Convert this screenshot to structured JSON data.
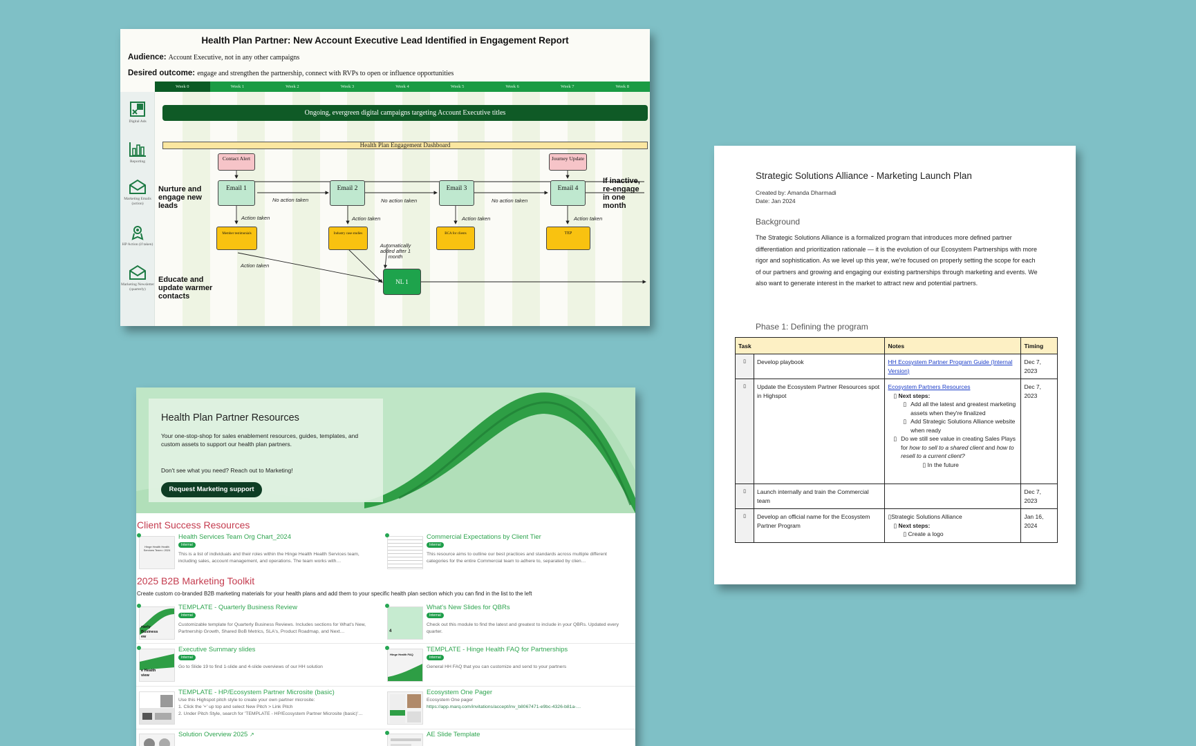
{
  "card1": {
    "title": "Health Plan Partner: New Account Executive Lead Identified in Engagement Report",
    "audience_label": "Audience:",
    "audience_value": "Account Executive, not in any other campaigns",
    "outcome_label": "Desired outcome:",
    "outcome_value": "engage and strengthen the partnership, connect with RVPs to open or influence opportunities",
    "weeks": [
      "Week 0",
      "Week 1",
      "Week 2",
      "Week 3",
      "Week 4",
      "Week 5",
      "Week 6",
      "Week 7",
      "Week 8"
    ],
    "side_icons": [
      "Digital Ads",
      "Reporting",
      "Marketing Emails (action)",
      "HP Action (if taken)",
      "Marketing Newsletter (quarterly)"
    ],
    "evergreen_bar": "Ongoing, evergreen digital campaigns targeting Account Executive titles",
    "dashboard_bar": "Health Plan Engagement Dashboard",
    "contact_alert": "Contact Alert",
    "journey_update": "Journey Update",
    "emails": [
      "Email 1",
      "Email 2",
      "Email 3",
      "Email 4"
    ],
    "no_action": "No action taken",
    "action_taken": "Action taken",
    "actions": [
      "Member testimonials",
      "Industry case studies",
      "BCA for clients",
      "TEP"
    ],
    "auto_added": "Automatically added after 1 month",
    "nl": "NL 1",
    "nurture_label": "Nurture and engage new leads",
    "inactive_label": "If inactive, re-engage in one month",
    "educate_label": "Educate and update warmer contacts"
  },
  "card2": {
    "title": "Strategic Solutions Alliance - Marketing Launch Plan",
    "created_by": "Created by: Amanda Dharmadi",
    "date": "Date: Jan 2024",
    "background_heading": "Background",
    "background_text": "The Strategic Solutions Alliance is a formalized program that introduces more defined partner differentiation and prioritization rationale — it is the evolution of our Ecosystem Partnerships with more rigor and sophistication. As we level up this year, we're focused on properly setting the scope for each of our partners and growing and engaging our existing partnerships through marketing and events. We also want to generate interest in the market to attract new and potential partners.",
    "phase_heading": "Phase 1: Defining the program",
    "table_headers": [
      "Task",
      "Notes",
      "Timing"
    ],
    "rows": [
      {
        "task": "Develop playbook",
        "note_link": "HH Ecosystem Partner Program Guide (Internal Version)",
        "timing": "Dec 7, 2023"
      },
      {
        "task": "Update the Ecosystem Partner Resources spot in Highspot",
        "note_link": "Ecosystem Partners Resources",
        "next_steps": "Next steps:",
        "sub1": "Add all the latest and greatest marketing assets when they're finalized",
        "sub2": "Add Strategic Solutions Alliance website when ready",
        "q_pre": "Do we still see value in creating Sales Plays for ",
        "q_em1": "how to sell to a shared client",
        "q_mid": " and ",
        "q_em2": "how to resell to a current client?",
        "future": "In the future",
        "timing": "Dec 7, 2023"
      },
      {
        "task": "Launch internally and train the Commercial team",
        "timing": "Dec 7, 2023"
      },
      {
        "task": "Develop an official name for the Ecosystem Partner Program",
        "note1": "Strategic Solutions Alliance",
        "next_steps": "Next steps:",
        "sub1": "Create a logo",
        "timing": "Jan 16, 2024"
      }
    ],
    "bullet_glyph": "▯"
  },
  "card3": {
    "hero_title": "Health Plan Partner Resources",
    "hero_desc": "Your one-stop-shop for sales enablement resources, guides, templates, and custom assets to support our health plan partners.",
    "hero_question": "Don't see what you need? Reach out to Marketing!",
    "hero_button": "Request Marketing support",
    "section1": "Client Success Resources",
    "section2": "2025 B2B Marketing Toolkit",
    "section2_sub": "Create custom co-branded B2B marketing materials for your health plans and add them to your specific health plan section which you can find in the list to the left",
    "badge": "Internal",
    "items": [
      {
        "title": "Health Services Team Org Chart_2024",
        "desc": "This is a list of individuals and their roles within the Hinge Health Health Services team, including sales, account management, and operations. The team works with…",
        "thumb": "Hinge Health Health Services Team • 2024"
      },
      {
        "title": "Commercial Expectations by Client Tier",
        "desc": "This resource aims to outline our best practices and standards across multiple different categories for the entire Commercial team to adhere to, separated by clien…"
      },
      {
        "title": "TEMPLATE - Quarterly Business Review",
        "desc": "Customizable template for Quarterly Business Reviews. Includes sections for What's New, Partnership Growth, Shared BoB Metrics, SLA's, Product Roadmap, and Next…",
        "thumb": "rterly Business ew"
      },
      {
        "title": "What's New Slides for QBRs",
        "desc": "Check out this module to find the latest and greatest to include in your QBRs. Updated every quarter.",
        "thumb": "4"
      },
      {
        "title": "Executive Summary slides",
        "desc": "Go to Slide 19 to find 1-slide and 4-slide overviews of our HH solution",
        "thumb": "e Health view"
      },
      {
        "title": "TEMPLATE - Hinge Health FAQ for Partnerships",
        "desc": "General HH FAQ that you can customize and send to your partners",
        "thumb": "Hinge Health FAQ"
      },
      {
        "title": "TEMPLATE - HP/Ecosystem Partner Microsite (basic)",
        "desc1": "Use this Highspot pitch style to create your own partner microsite:",
        "desc2": "1. Click the '+' up top and select New Pitch > Link Pitch",
        "desc3": "2. Under Pitch Style, search for 'TEMPLATE - HP/Ecosystem Partner Microsite (basic)'…"
      },
      {
        "title": "Ecosystem One Pager",
        "desc1": "Ecosystem One pager",
        "desc2": "https://app.marq.com/invitations/accept/inv_b8067471-e9bc-4326-b81a-…"
      },
      {
        "title": "Solution Overview 2025"
      },
      {
        "title": "AE Slide Template"
      }
    ]
  }
}
